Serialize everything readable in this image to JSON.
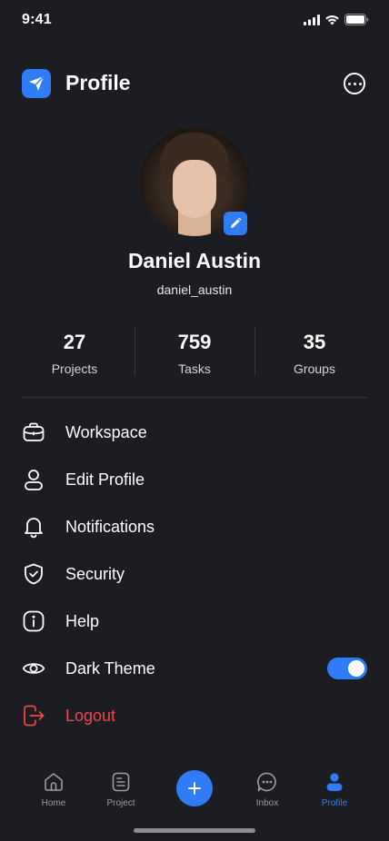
{
  "status_bar": {
    "time": "9:41"
  },
  "header": {
    "title": "Profile"
  },
  "profile": {
    "name": "Daniel Austin",
    "username": "daniel_austin"
  },
  "stats": [
    {
      "value": "27",
      "label": "Projects"
    },
    {
      "value": "759",
      "label": "Tasks"
    },
    {
      "value": "35",
      "label": "Groups"
    }
  ],
  "menu": {
    "workspace": "Workspace",
    "edit_profile": "Edit Profile",
    "notifications": "Notifications",
    "security": "Security",
    "help": "Help",
    "dark_theme": "Dark Theme",
    "dark_theme_enabled": true,
    "logout": "Logout"
  },
  "tabs": {
    "home": "Home",
    "project": "Project",
    "inbox": "Inbox",
    "profile": "Profile",
    "active": "profile"
  },
  "icons": {
    "logo": "paper-plane-icon",
    "more": "more-horizontal-icon",
    "edit": "pencil-icon",
    "workspace": "briefcase-icon",
    "edit_profile": "user-icon",
    "notifications": "bell-icon",
    "security": "shield-check-icon",
    "help": "info-icon",
    "dark_theme": "eye-icon",
    "logout": "logout-icon",
    "add": "plus-icon"
  },
  "colors": {
    "background": "#1c1d22",
    "accent": "#2f7cf6",
    "danger": "#f0454b",
    "text": "#ffffff",
    "muted": "#9a9ca3"
  }
}
